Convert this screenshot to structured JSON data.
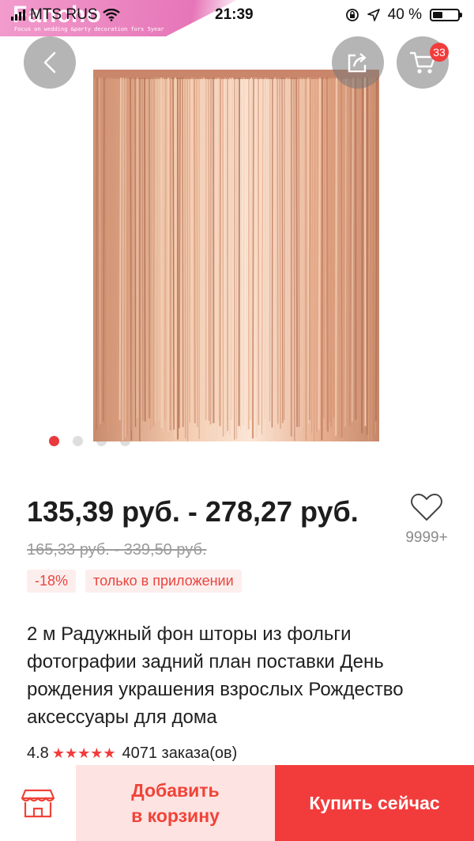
{
  "status_bar": {
    "carrier": "MTS RUS",
    "time": "21:39",
    "battery_percent": "40 %",
    "battery_level": 0.4
  },
  "shop": {
    "name": "Fancho",
    "tagline": "Focus on wedding &party decoration fors 5year"
  },
  "header": {
    "back_icon": "chevron-left-icon",
    "share_icon": "share-icon",
    "cart_icon": "cart-icon",
    "cart_count": "33"
  },
  "gallery": {
    "image_count": 4,
    "active_index": 0,
    "image_colors": [
      "#d99a78",
      "#f3cfb7",
      "#b9765a"
    ]
  },
  "price": {
    "range": "135,39 руб. - 278,27 руб.",
    "old_range": "165,33 руб. - 339,50 руб.",
    "discount": "-18%",
    "app_only": "только в приложении"
  },
  "wishlist": {
    "icon": "heart-outline-icon",
    "count": "9999+"
  },
  "product": {
    "title": "2 м Радужный фон шторы из фольги фотографии задний план поставки День рождения украшения взрослых Рождество аксессуары для дома",
    "rating": "4.8",
    "stars": "★★★★★",
    "orders": "4071 заказа(ов)"
  },
  "actions": {
    "store_icon": "store-icon",
    "add_to_cart_line1": "Добавить",
    "add_to_cart_line2": "в корзину",
    "buy_now": "Купить сейчас"
  },
  "colors": {
    "accent": "#f23c3c",
    "accent_light": "#fde3e2"
  }
}
